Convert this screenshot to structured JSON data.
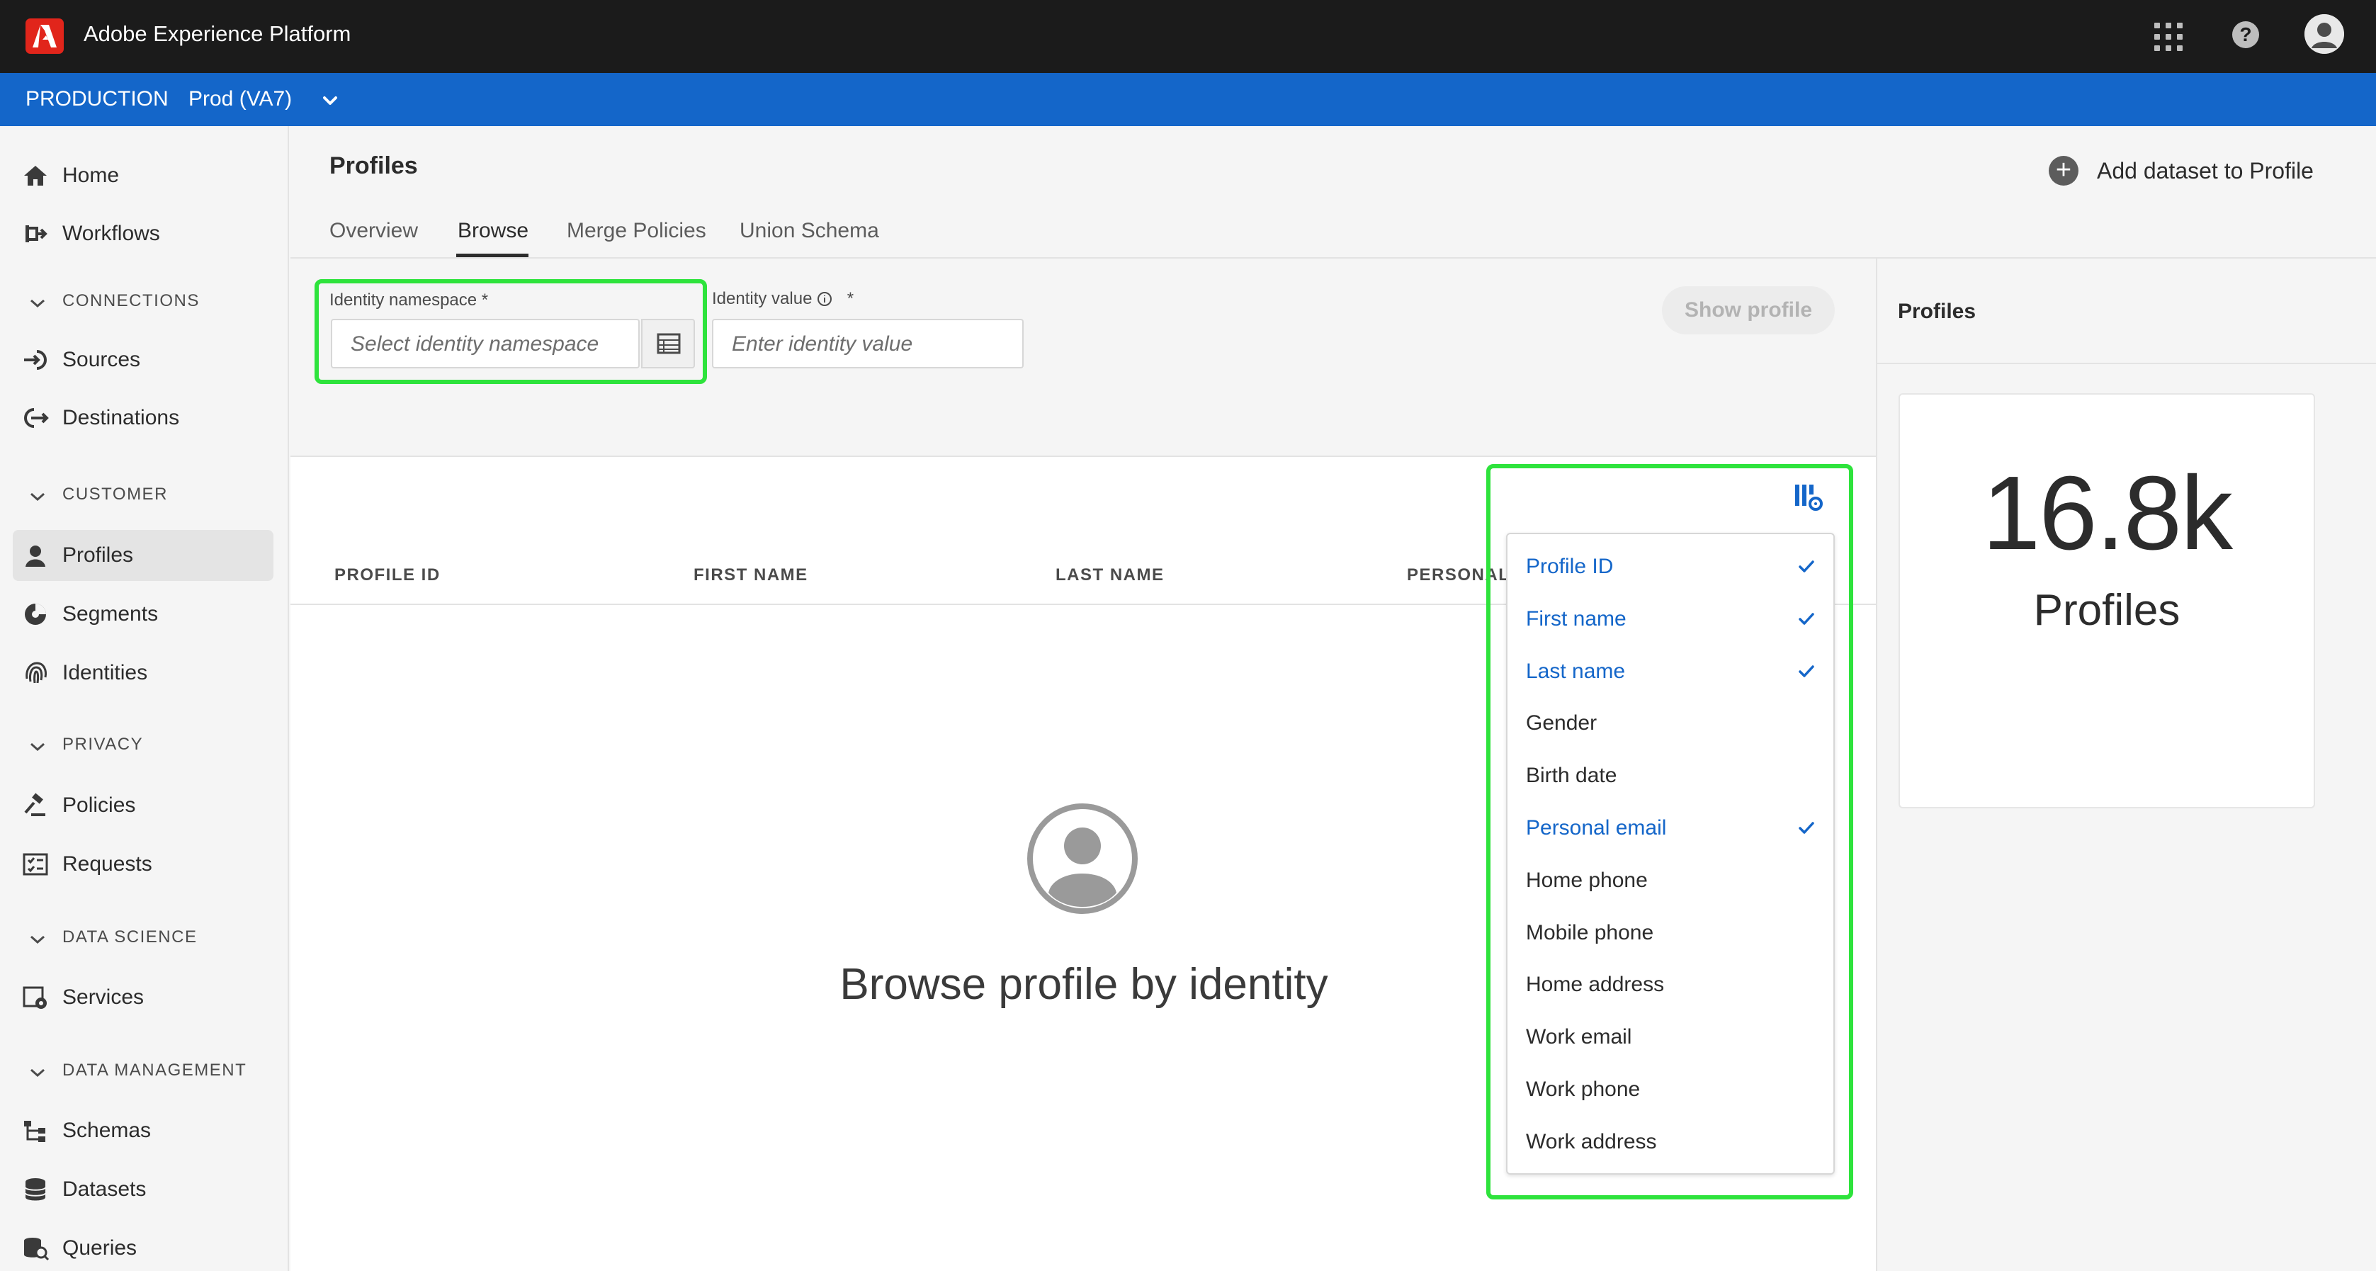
{
  "app": {
    "title": "Adobe Experience Platform"
  },
  "sandbox": {
    "environment": "PRODUCTION",
    "name": "Prod (VA7)"
  },
  "sidebar": {
    "items_top": [
      {
        "label": "Home",
        "icon": "home-icon"
      },
      {
        "label": "Workflows",
        "icon": "workflows-icon"
      }
    ],
    "sections": [
      {
        "title": "CONNECTIONS",
        "items": [
          {
            "label": "Sources",
            "icon": "sources-icon"
          },
          {
            "label": "Destinations",
            "icon": "destinations-icon"
          }
        ]
      },
      {
        "title": "CUSTOMER",
        "items": [
          {
            "label": "Profiles",
            "icon": "profiles-icon",
            "active": true
          },
          {
            "label": "Segments",
            "icon": "segments-icon"
          },
          {
            "label": "Identities",
            "icon": "identities-icon"
          }
        ]
      },
      {
        "title": "PRIVACY",
        "items": [
          {
            "label": "Policies",
            "icon": "policies-icon"
          },
          {
            "label": "Requests",
            "icon": "requests-icon"
          }
        ]
      },
      {
        "title": "DATA SCIENCE",
        "items": [
          {
            "label": "Services",
            "icon": "services-icon"
          }
        ]
      },
      {
        "title": "DATA MANAGEMENT",
        "items": [
          {
            "label": "Schemas",
            "icon": "schemas-icon"
          },
          {
            "label": "Datasets",
            "icon": "datasets-icon"
          },
          {
            "label": "Queries",
            "icon": "queries-icon"
          }
        ]
      }
    ]
  },
  "page": {
    "title": "Profiles",
    "add_dataset_label": "Add dataset to Profile",
    "tabs": [
      "Overview",
      "Browse",
      "Merge Policies",
      "Union Schema"
    ],
    "active_tab": "Browse"
  },
  "form": {
    "namespace_label": "Identity namespace",
    "namespace_placeholder": "Select identity namespace",
    "value_label": "Identity value",
    "value_placeholder": "Enter identity value",
    "required_mark": "*",
    "info_icon": "info-icon",
    "show_profile_label": "Show profile"
  },
  "table": {
    "headers": [
      "PROFILE ID",
      "FIRST NAME",
      "LAST NAME",
      "PERSONAL"
    ],
    "empty_message": "Browse profile by identity"
  },
  "column_menu": {
    "items": [
      {
        "label": "Profile ID",
        "selected": true
      },
      {
        "label": "First name",
        "selected": true
      },
      {
        "label": "Last name",
        "selected": true
      },
      {
        "label": "Gender",
        "selected": false
      },
      {
        "label": "Birth date",
        "selected": false
      },
      {
        "label": "Personal email",
        "selected": true
      },
      {
        "label": "Home phone",
        "selected": false
      },
      {
        "label": "Mobile phone",
        "selected": false
      },
      {
        "label": "Home address",
        "selected": false
      },
      {
        "label": "Work email",
        "selected": false
      },
      {
        "label": "Work phone",
        "selected": false
      },
      {
        "label": "Work address",
        "selected": false
      }
    ]
  },
  "right_rail": {
    "title": "Profiles",
    "count_value": "16.8k",
    "count_label": "Profiles"
  },
  "colors": {
    "accent": "#1466c9",
    "highlight": "#2ee33c",
    "topbar": "#1b1b1b",
    "brand_red": "#e1251b"
  }
}
